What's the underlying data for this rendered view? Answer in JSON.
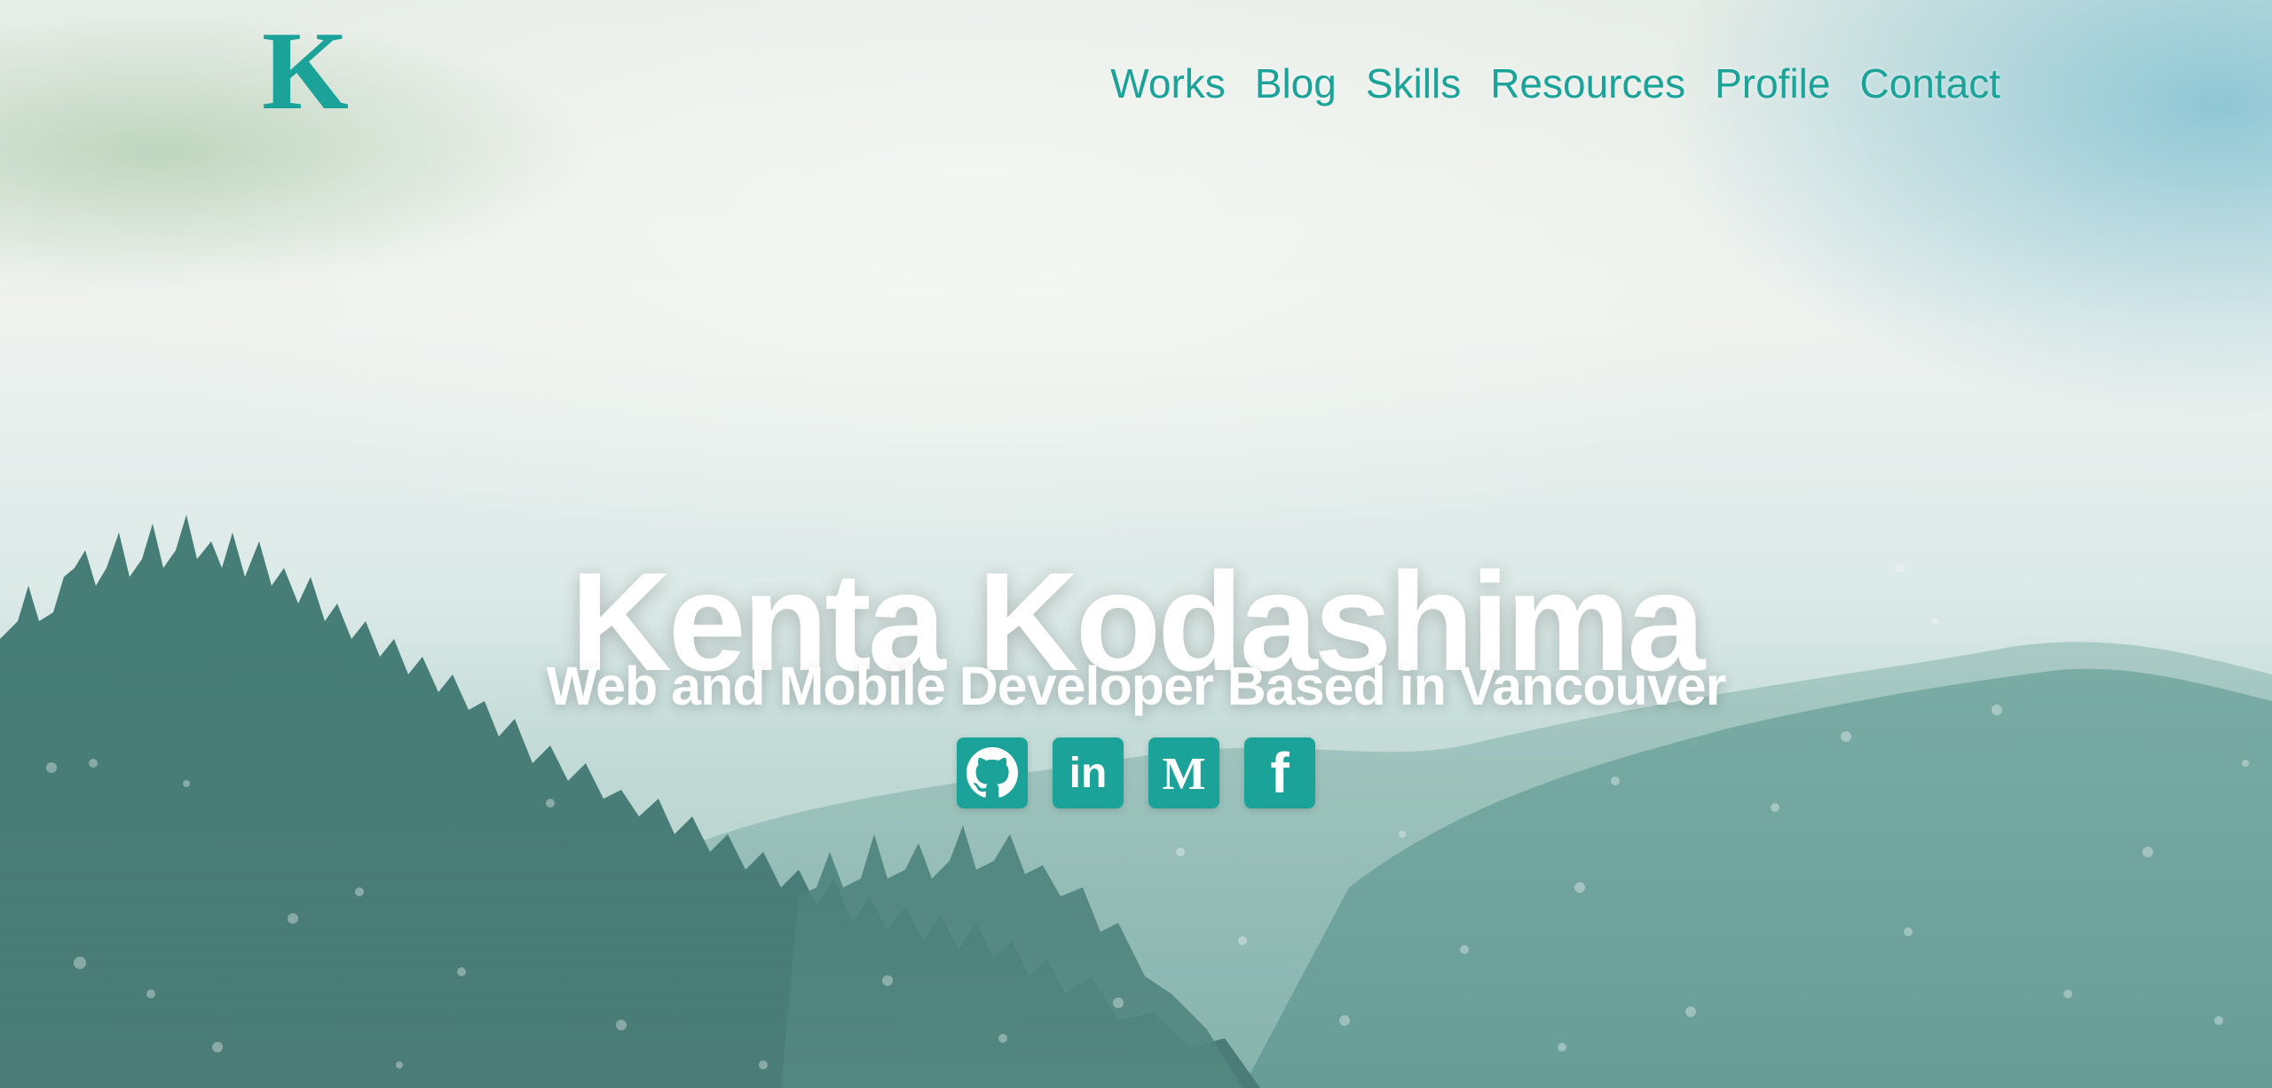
{
  "logo": {
    "letter": "K"
  },
  "nav": {
    "items": [
      "Works",
      "Blog",
      "Skills",
      "Resources",
      "Profile",
      "Contact"
    ]
  },
  "hero": {
    "title": "Kenta Kodashima",
    "subtitle": "Web and Mobile Developer Based in Vancouver"
  },
  "social": [
    {
      "icon": "github-icon"
    },
    {
      "icon": "linkedin-icon",
      "glyph": "in"
    },
    {
      "icon": "medium-icon",
      "glyph": "M"
    },
    {
      "icon": "facebook-icon",
      "glyph": "f"
    }
  ],
  "colors": {
    "accent": "#1ba39a",
    "text_on_hero": "#ffffff"
  }
}
